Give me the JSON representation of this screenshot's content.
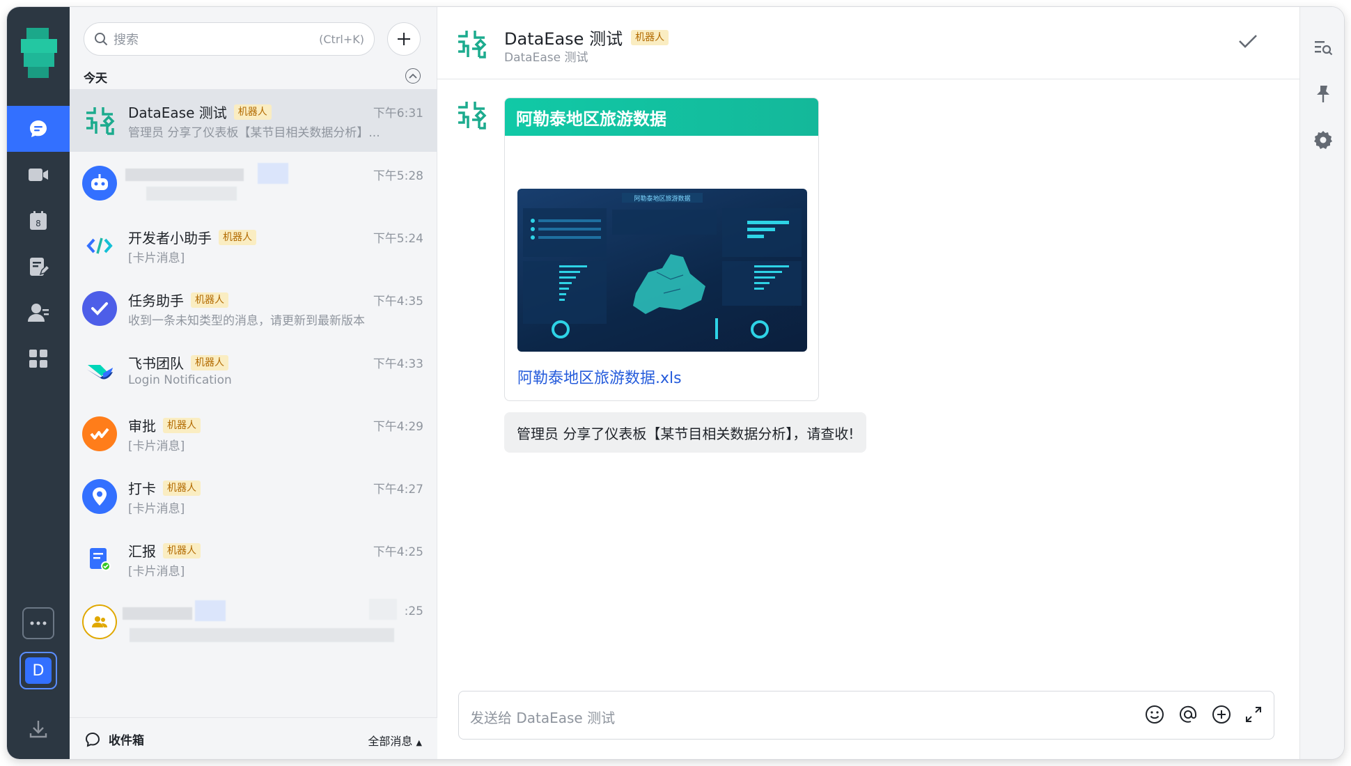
{
  "sidebar": {
    "me_initial": "D"
  },
  "search": {
    "placeholder": "搜索",
    "shortcut": "(Ctrl+K)"
  },
  "chat_list": {
    "section_title": "今天",
    "items": [
      {
        "name": "DataEase 测试",
        "badge": "机器人",
        "time": "下午6:31",
        "preview": "管理员 分享了仪表板【某节目相关数据分析】..."
      },
      {
        "name": "",
        "badge": "",
        "time": "下午5:28",
        "preview": ""
      },
      {
        "name": "开发者小助手",
        "badge": "机器人",
        "time": "下午5:24",
        "preview": "[卡片消息]"
      },
      {
        "name": "任务助手",
        "badge": "机器人",
        "time": "下午4:35",
        "preview": "收到一条未知类型的消息，请更新到最新版本"
      },
      {
        "name": "飞书团队",
        "badge": "机器人",
        "time": "下午4:33",
        "preview": "Login Notification"
      },
      {
        "name": "审批",
        "badge": "机器人",
        "time": "下午4:29",
        "preview": "[卡片消息]"
      },
      {
        "name": "打卡",
        "badge": "机器人",
        "time": "下午4:27",
        "preview": "[卡片消息]"
      },
      {
        "name": "汇报",
        "badge": "机器人",
        "time": "下午4:25",
        "preview": "[卡片消息]"
      },
      {
        "name": "",
        "badge": "",
        "time": ":25",
        "preview": ""
      }
    ],
    "footer": {
      "inbox_label": "收件箱",
      "all_messages_label": "全部消息"
    }
  },
  "chat": {
    "title": "DataEase 测试",
    "badge": "机器人",
    "subtitle": "DataEase 测试",
    "card": {
      "header": "阿勒泰地区旅游数据",
      "link": "阿勒泰地区旅游数据.xls",
      "dashboard_title": "阿勒泰地区旅游数据"
    },
    "message": "管理员 分享了仪表板【某节目相关数据分析】，请查收!",
    "composer_placeholder": "发送给 DataEase 测试"
  },
  "colors": {
    "rail_bg": "#2c3742",
    "accent": "#3370ff",
    "card_header": "#11c9a6",
    "link": "#245bdb",
    "badge_bg": "#faedc2",
    "badge_text": "#b26a00"
  }
}
